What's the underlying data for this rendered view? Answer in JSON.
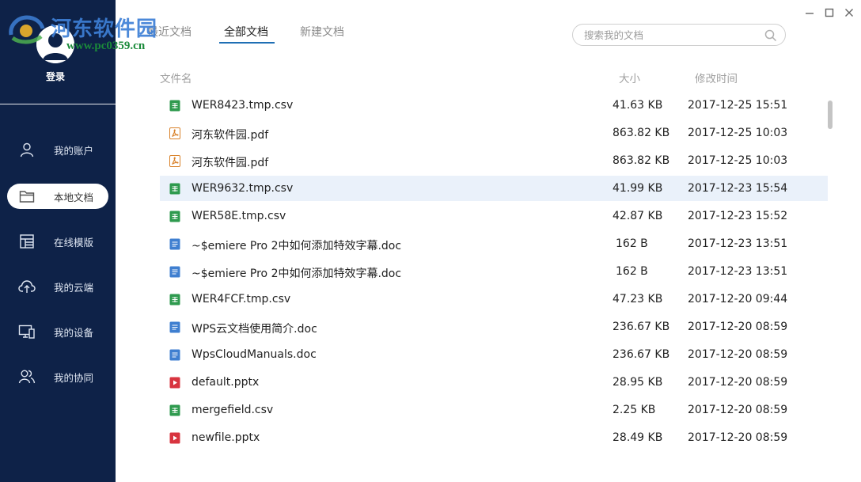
{
  "watermark": {
    "title": "河东软件园",
    "url": "www.pc0359.cn"
  },
  "sidebar": {
    "login_label": "登录",
    "items": [
      {
        "label": "我的账户",
        "icon": "user-icon"
      },
      {
        "label": "本地文档",
        "icon": "folder-icon",
        "active": true
      },
      {
        "label": "在线模版",
        "icon": "template-icon"
      },
      {
        "label": "我的云端",
        "icon": "cloud-upload-icon"
      },
      {
        "label": "我的设备",
        "icon": "devices-icon"
      },
      {
        "label": "我的协同",
        "icon": "collaboration-icon"
      }
    ]
  },
  "tabs": [
    {
      "label": "最近文档"
    },
    {
      "label": "全部文档",
      "active": true
    },
    {
      "label": "新建文档"
    }
  ],
  "search": {
    "placeholder": "搜索我的文档",
    "value": ""
  },
  "table": {
    "headers": {
      "name": "文件名",
      "size": "大小",
      "modified": "修改时间"
    },
    "rows": [
      {
        "name": "WER8423.tmp.csv",
        "size": "41.63 KB",
        "modified": "2017-12-25 15:51",
        "type": "csv"
      },
      {
        "name": "河东软件园.pdf",
        "size": "863.82 KB",
        "modified": "2017-12-25 10:03",
        "type": "pdf"
      },
      {
        "name": "河东软件园.pdf",
        "size": "863.82 KB",
        "modified": "2017-12-25 10:03",
        "type": "pdf"
      },
      {
        "name": "WER9632.tmp.csv",
        "size": "41.99 KB",
        "modified": "2017-12-23 15:54",
        "type": "csv",
        "selected": true
      },
      {
        "name": "WER58E.tmp.csv",
        "size": "42.87 KB",
        "modified": "2017-12-23 15:52",
        "type": "csv"
      },
      {
        "name": "~$emiere Pro 2中如何添加特效字幕.doc",
        "size": "162 B",
        "modified": "2017-12-23 13:51",
        "type": "doc"
      },
      {
        "name": "~$emiere Pro 2中如何添加特效字幕.doc",
        "size": "162 B",
        "modified": "2017-12-23 13:51",
        "type": "doc"
      },
      {
        "name": "WER4FCF.tmp.csv",
        "size": "47.23 KB",
        "modified": "2017-12-20 09:44",
        "type": "csv"
      },
      {
        "name": "WPS云文档使用简介.doc",
        "size": "236.67 KB",
        "modified": "2017-12-20 08:59",
        "type": "doc"
      },
      {
        "name": "WpsCloudManuals.doc",
        "size": "236.67 KB",
        "modified": "2017-12-20 08:59",
        "type": "doc"
      },
      {
        "name": "default.pptx",
        "size": "28.95 KB",
        "modified": "2017-12-20 08:59",
        "type": "pptx"
      },
      {
        "name": "mergefield.csv",
        "size": "2.25 KB",
        "modified": "2017-12-20 08:59",
        "type": "csv"
      },
      {
        "name": "newfile.pptx",
        "size": "28.49 KB",
        "modified": "2017-12-20 08:59",
        "type": "pptx"
      }
    ]
  },
  "colors": {
    "sidebar_bg": "#0e2248",
    "accent": "#1f6fb4",
    "selected_row": "#eaf1fa",
    "csv_icon": "#2e9a4e",
    "pdf_icon": "#d9822b",
    "doc_icon": "#3f7fd0",
    "pptx_icon": "#d8343f"
  }
}
